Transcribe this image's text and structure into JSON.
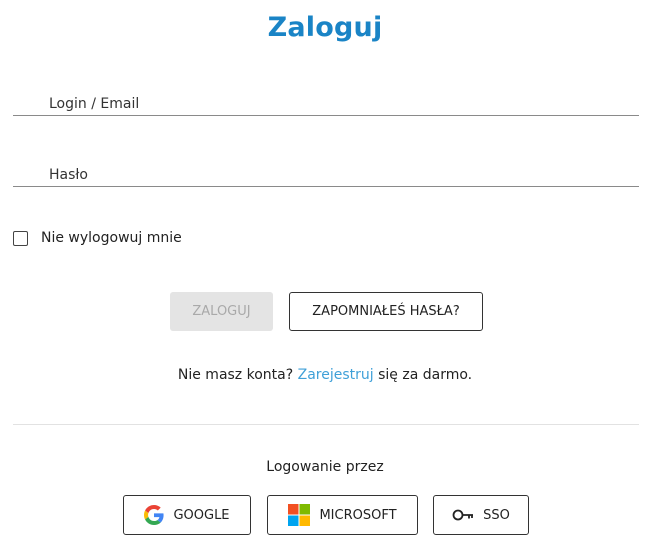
{
  "title": "Zaloguj",
  "form": {
    "login_placeholder": "Login / Email",
    "password_placeholder": "Hasło",
    "remember_label": "Nie wylogowuj mnie",
    "remember_checked": false
  },
  "buttons": {
    "login_label": "ZALOGUJ",
    "forgot_label": "ZAPOMNIAŁEŚ HASŁA?"
  },
  "register": {
    "prefix": "Nie masz konta?",
    "link": "Zarejestruj",
    "suffix": "się za darmo."
  },
  "social": {
    "heading": "Logowanie przez",
    "google_label": "GOOGLE",
    "microsoft_label": "MICROSOFT",
    "sso_label": "SSO"
  },
  "colors": {
    "accent": "#1a84c6",
    "link": "#3fa0d8",
    "disabled_bg": "#e4e4e4",
    "disabled_text": "#a9a9a9"
  },
  "icons": {
    "google": "google-logo-icon",
    "microsoft": "microsoft-logo-icon",
    "sso": "key-icon"
  }
}
